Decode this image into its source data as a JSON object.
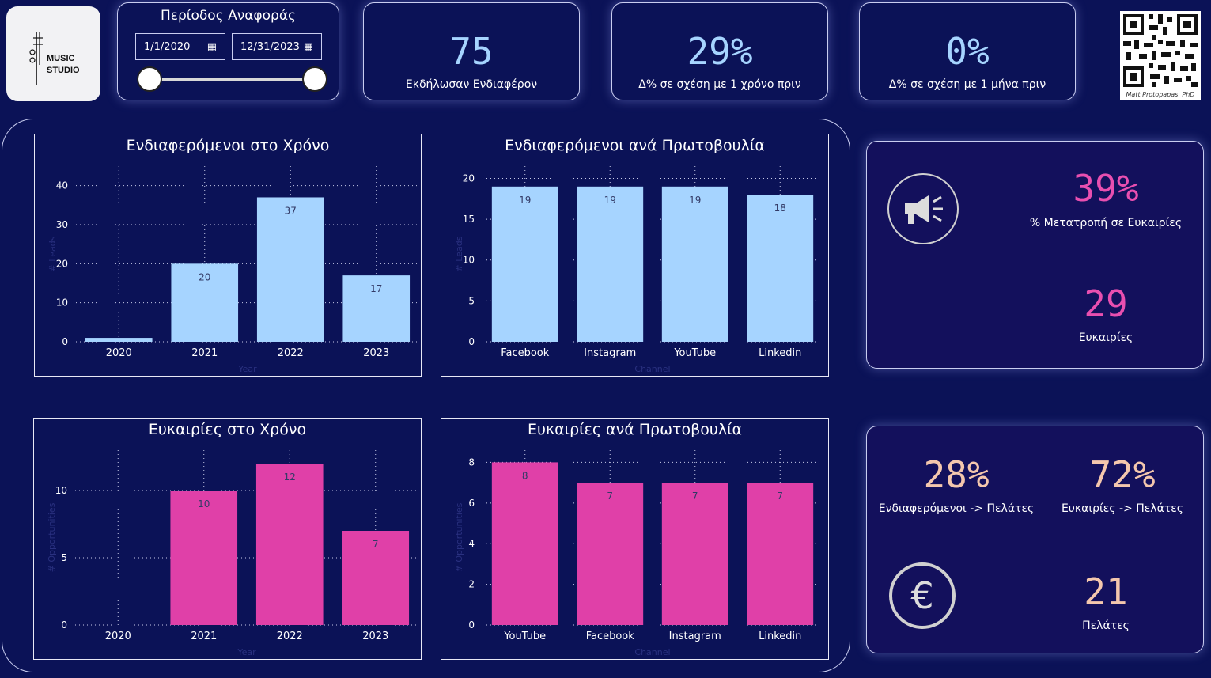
{
  "logo": {
    "line1": "MUSIC",
    "line2": "STUDIO"
  },
  "period": {
    "title": "Περίοδος Αναφοράς",
    "start": "1/1/2020",
    "end": "12/31/2023"
  },
  "kpis": [
    {
      "value": "75",
      "label": "Εκδήλωσαν Ενδιαφέρον"
    },
    {
      "value": "29%",
      "label": "Δ% σε σχέση με 1 χρόνο πριν"
    },
    {
      "value": "0%",
      "label": "Δ% σε σχέση με 1 μήνα πριν"
    }
  ],
  "qr": {
    "caption": "Matt Protopapas, PhD"
  },
  "colors": {
    "lead_bar": "#a6d4ff",
    "opp_bar": "#e040a8",
    "pink_text": "#e94fb0",
    "peach_text": "#f4c7ad"
  },
  "side": {
    "conversion_value": "39%",
    "conversion_label": "% Μετατροπή σε Ευκαιρίες",
    "opportunities_value": "29",
    "opportunities_label": "Ευκαιρίες",
    "leads_to_clients_value": "28%",
    "leads_to_clients_label": "Ενδιαφερόμενοι -> Πελάτες",
    "opps_to_clients_value": "72%",
    "opps_to_clients_label": "Ευκαιρίες -> Πελάτες",
    "clients_value": "21",
    "clients_label": "Πελάτες",
    "megaphone_icon": "megaphone-icon",
    "euro_icon": "euro-icon"
  },
  "chart_data": [
    {
      "type": "bar",
      "title": "Ενδιαφερόμενοι στο Χρόνο",
      "categories": [
        "2020",
        "2021",
        "2022",
        "2023"
      ],
      "values": [
        1,
        20,
        37,
        17
      ],
      "data_labels": [
        "",
        "20",
        "37",
        "17"
      ],
      "ylim": [
        0,
        45
      ],
      "yticks": [
        0,
        10,
        20,
        30,
        40
      ],
      "xlabel": "Year",
      "ylabel": "# Leads",
      "grid": true
    },
    {
      "type": "bar",
      "title": "Ενδιαφερόμενοι ανά Πρωτοβουλία",
      "categories": [
        "Facebook",
        "Instagram",
        "YouTube",
        "Linkedin"
      ],
      "values": [
        19,
        19,
        19,
        18
      ],
      "data_labels": [
        "19",
        "19",
        "19",
        "18"
      ],
      "ylim": [
        0,
        21.5
      ],
      "yticks": [
        0,
        5,
        10,
        15,
        20
      ],
      "xlabel": "Channel",
      "ylabel": "# Leads",
      "grid": true
    },
    {
      "type": "bar",
      "title": "Ευκαιρίες στο Χρόνο",
      "categories": [
        "2020",
        "2021",
        "2022",
        "2023"
      ],
      "values": [
        0,
        10,
        12,
        7
      ],
      "data_labels": [
        "",
        "10",
        "12",
        "7"
      ],
      "ylim": [
        0,
        13
      ],
      "yticks": [
        0,
        5,
        10
      ],
      "xlabel": "Year",
      "ylabel": "# Opportunities",
      "grid": true
    },
    {
      "type": "bar",
      "title": "Ευκαιρίες ανά Πρωτοβουλία",
      "categories": [
        "YouTube",
        "Facebook",
        "Instagram",
        "Linkedin"
      ],
      "values": [
        8,
        7,
        7,
        7
      ],
      "data_labels": [
        "8",
        "7",
        "7",
        "7"
      ],
      "ylim": [
        0,
        8.6
      ],
      "yticks": [
        0,
        2,
        4,
        6,
        8
      ],
      "xlabel": "Channel",
      "ylabel": "# Opportunities",
      "grid": true
    }
  ]
}
